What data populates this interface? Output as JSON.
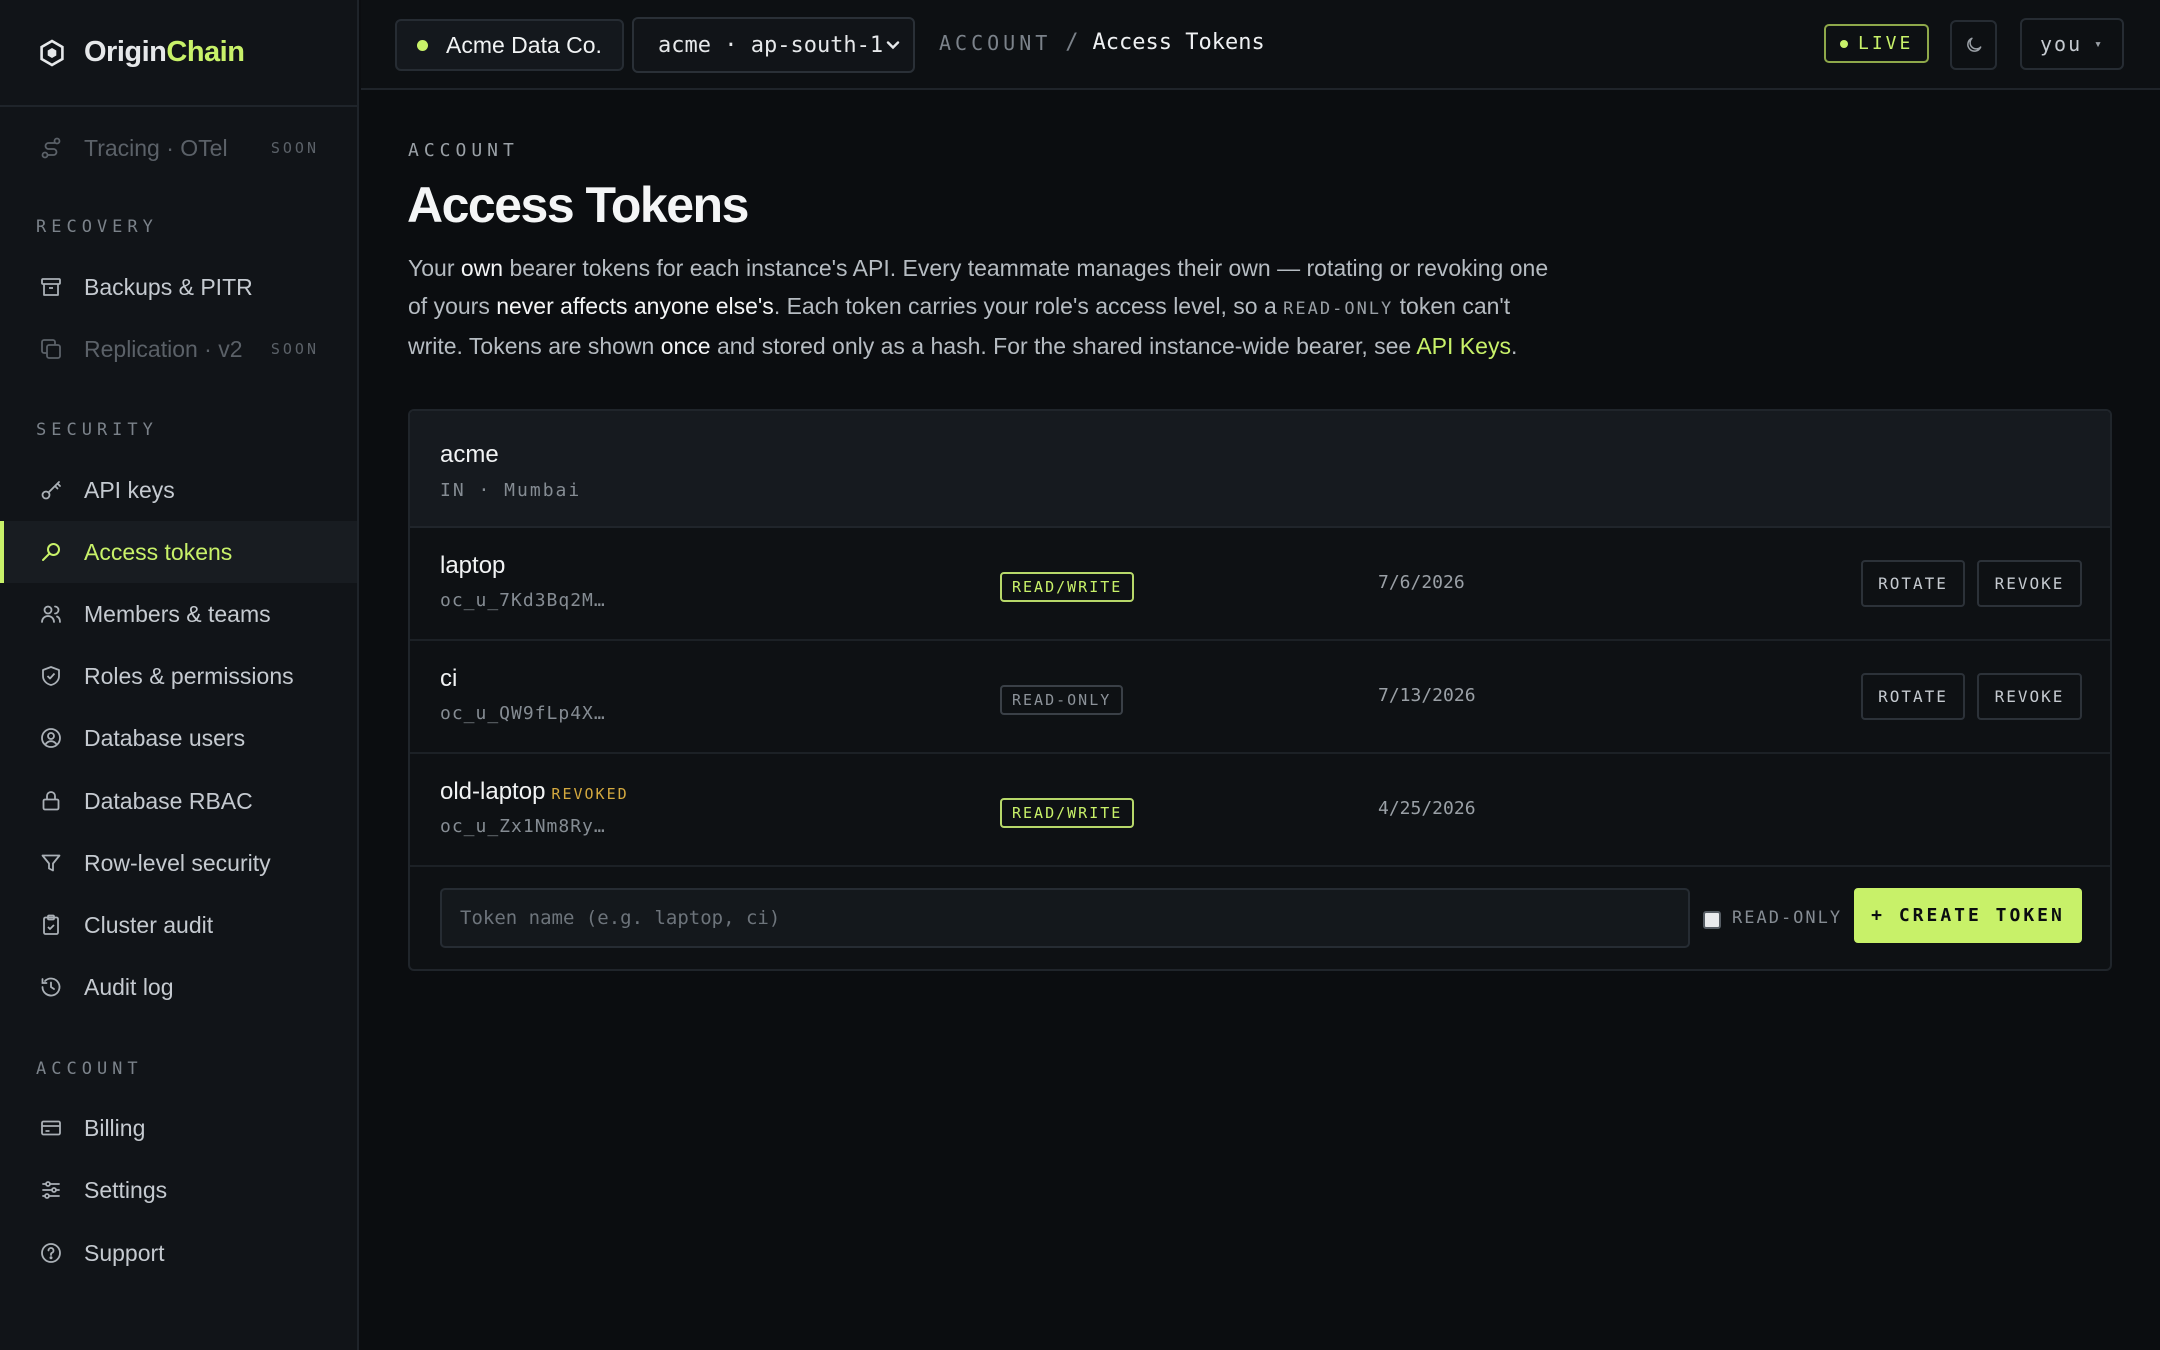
{
  "brand": {
    "name_part1": "Origin",
    "name_part2": "Chain"
  },
  "colors": {
    "accent": "#c8f169",
    "background": "#0b0d10",
    "warning": "#d4a93f"
  },
  "sidebar": {
    "items_top": [
      {
        "label": "Tracing · OTel",
        "badge": "SOON",
        "icon": "tracing-icon",
        "disabled": true
      }
    ],
    "sections": [
      {
        "title": "RECOVERY",
        "items": [
          {
            "label": "Backups & PITR",
            "icon": "archive-icon"
          },
          {
            "label": "Replication · v2",
            "badge": "SOON",
            "icon": "replication-icon",
            "disabled": true
          }
        ]
      },
      {
        "title": "SECURITY",
        "items": [
          {
            "label": "API keys",
            "icon": "key-icon"
          },
          {
            "label": "Access tokens",
            "icon": "search-key-icon",
            "active": true
          },
          {
            "label": "Members & teams",
            "icon": "users-icon"
          },
          {
            "label": "Roles & permissions",
            "icon": "shield-icon"
          },
          {
            "label": "Database users",
            "icon": "user-circle-icon"
          },
          {
            "label": "Database RBAC",
            "icon": "lock-icon"
          },
          {
            "label": "Row-level security",
            "icon": "filter-icon"
          },
          {
            "label": "Cluster audit",
            "icon": "clipboard-icon"
          },
          {
            "label": "Audit log",
            "icon": "history-icon"
          }
        ]
      },
      {
        "title": "ACCOUNT",
        "items": [
          {
            "label": "Billing",
            "icon": "card-icon"
          },
          {
            "label": "Settings",
            "icon": "sliders-icon"
          },
          {
            "label": "Support",
            "icon": "help-icon"
          }
        ]
      }
    ]
  },
  "topbar": {
    "org": "Acme Data Co.",
    "env": "acme · ap-south-1",
    "breadcrumb_section": "ACCOUNT",
    "breadcrumb_sep": "/",
    "breadcrumb_page": "Access Tokens",
    "live": "LIVE",
    "user": "you",
    "user_caret": "▾"
  },
  "main": {
    "eyebrow": "ACCOUNT",
    "title": "Access Tokens",
    "intro": {
      "t1": "Your ",
      "b1": "own",
      "t2": " bearer tokens for each instance's API. Every teammate manages their own — rotating or revoking one of yours ",
      "b2": "never affects anyone else's",
      "t3": ". Each token carries your role's access level, so a ",
      "tag": "READ-ONLY",
      "t4": " token can't write. Tokens are shown ",
      "b3": "once",
      "t5": " and stored only as a hash. For the shared instance-wide bearer, see ",
      "link": "API Keys",
      "t6": "."
    },
    "instance": {
      "name": "acme",
      "location": "IN · Mumbai"
    },
    "tokens": [
      {
        "name": "laptop",
        "token": "oc_u_7Kd3Bq2M…",
        "access": "READ/WRITE",
        "date": "7/6/2026",
        "rotate": "ROTATE",
        "revoke": "REVOKE"
      },
      {
        "name": "ci",
        "token": "oc_u_QW9fLp4X…",
        "access": "READ-ONLY",
        "date": "7/13/2026",
        "rotate": "ROTATE",
        "revoke": "REVOKE"
      },
      {
        "name": "old-laptop",
        "status": "REVOKED",
        "token": "oc_u_Zx1Nm8Ry…",
        "access": "READ/WRITE",
        "date": "4/25/2026"
      }
    ],
    "create": {
      "placeholder": "Token name (e.g. laptop, ci)",
      "readonly_label": "READ-ONLY",
      "button": "+ CREATE TOKEN"
    }
  }
}
